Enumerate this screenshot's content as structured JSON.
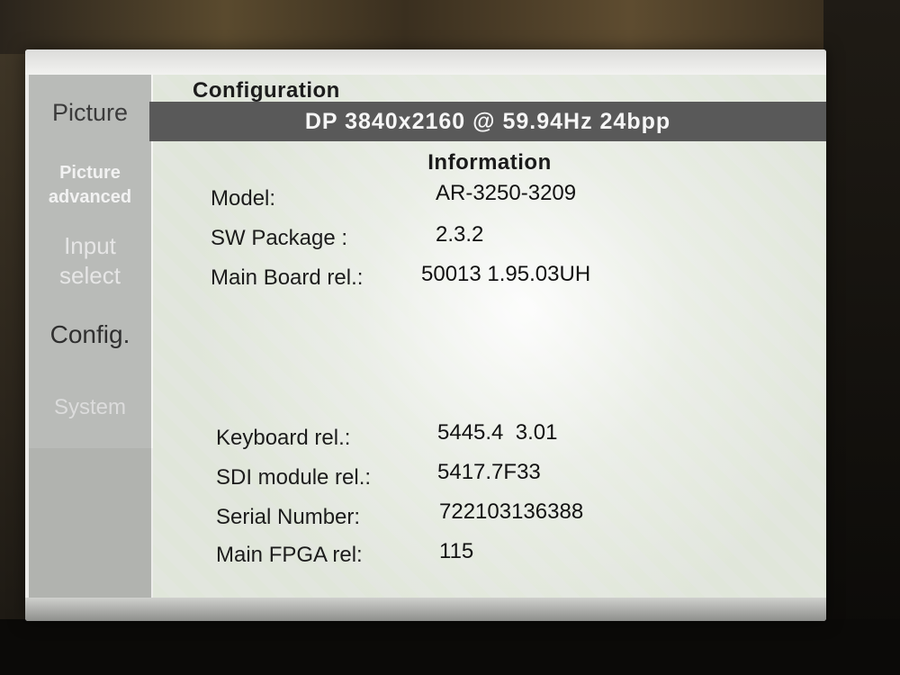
{
  "sidebar": {
    "items": [
      {
        "label": "Picture"
      },
      {
        "label_line1": "Picture",
        "label_line2": "advanced"
      },
      {
        "label_line1": "Input",
        "label_line2": "select"
      },
      {
        "label": "Config."
      },
      {
        "label": "System"
      }
    ],
    "selected": "Config."
  },
  "main": {
    "section_title": "Configuration",
    "signal_info": "DP 3840x2160 @ 59.94Hz 24bpp",
    "info_heading": "Information",
    "rows": [
      {
        "label": "Model:",
        "value": "AR-3250-3209"
      },
      {
        "label": "SW Package :",
        "value": "2.3.2"
      },
      {
        "label": "Main Board rel.:",
        "value": "50013 1.95.03UH"
      },
      {
        "label": "Keyboard rel.:",
        "value": "5445.4  3.01"
      },
      {
        "label": "SDI module rel.:",
        "value": "5417.7F33"
      },
      {
        "label": "Serial Number:",
        "value": "722103136388"
      },
      {
        "label": "Main FPGA rel:",
        "value": "115"
      }
    ]
  },
  "colors": {
    "signal_bar": "#595959",
    "sidebar": "#b9bbb8",
    "panel": "#ececea"
  }
}
